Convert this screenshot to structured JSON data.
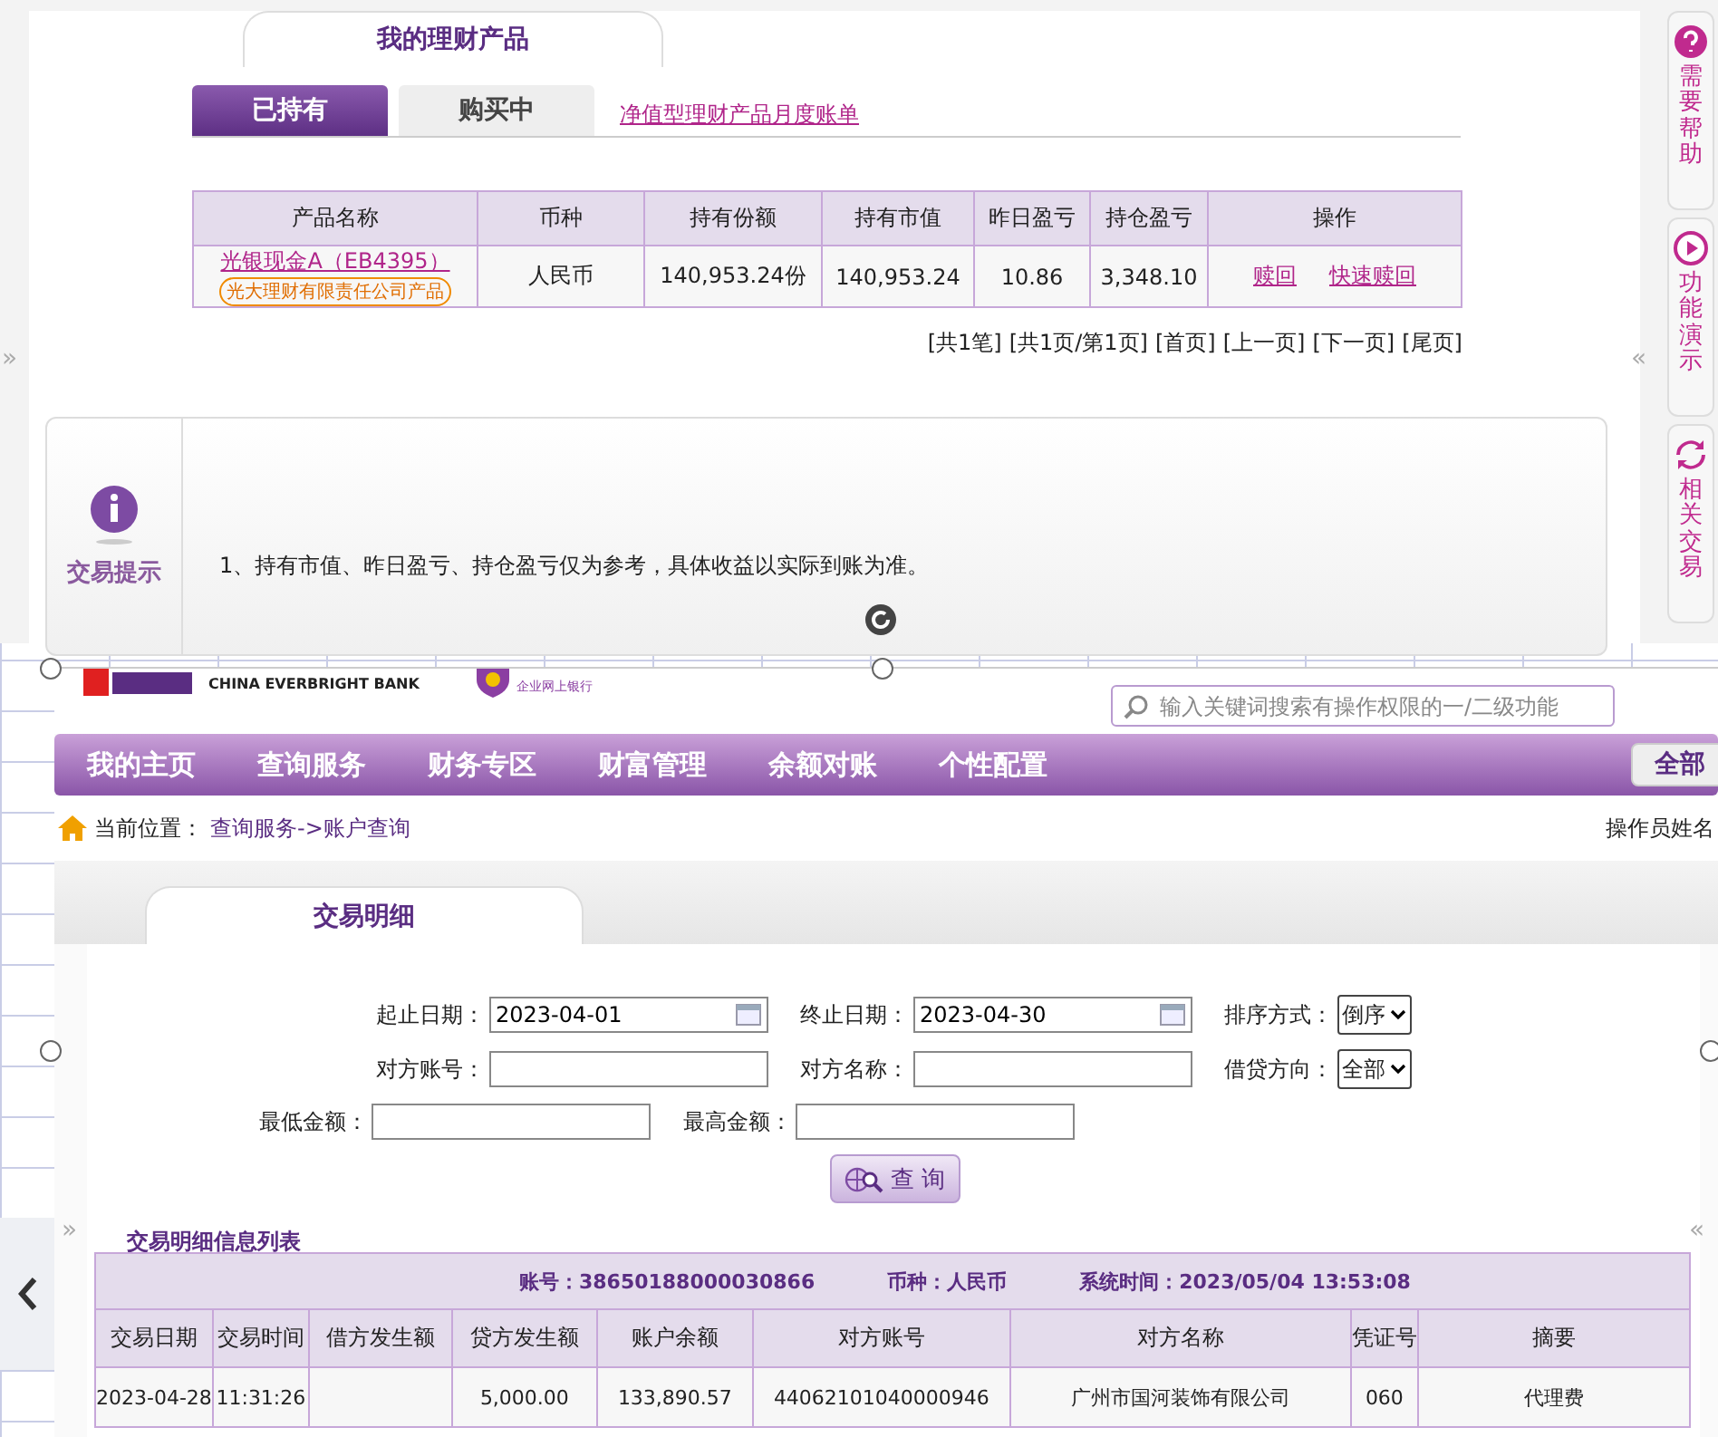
{
  "top_page": {
    "section_title": "我的理财产品",
    "tabs": [
      {
        "label": "已持有",
        "selected": true
      },
      {
        "label": "购买中",
        "selected": false
      }
    ],
    "statement_link": "净值型理财产品月度账单",
    "table": {
      "columns": [
        "产品名称",
        "币种",
        "持有份额",
        "持有市值",
        "昨日盈亏",
        "持仓盈亏",
        "操作"
      ],
      "rows": [
        {
          "product_name": "光银现金A（EB4395）",
          "issuer_badge": "光大理财有限责任公司产品",
          "currency": "人民币",
          "shares": "140,953.24份",
          "market_value": "140,953.24",
          "yesterday_pnl": "10.86",
          "position_pnl": "3,348.10",
          "actions": [
            "赎回",
            "快速赎回"
          ]
        }
      ]
    },
    "pagination": [
      "[共1笔]",
      "[共1页/第1页]",
      "[首页]",
      "[上一页]",
      "[下一页]",
      "[尾页]"
    ],
    "tips": {
      "label": "交易提示",
      "items": [
        "1、持有市值、昨日盈亏、持仓盈亏仅为参考，具体收益以实际到账为准。"
      ]
    },
    "left_toggle": "»",
    "right_toggle": "«",
    "side_buttons": [
      {
        "kind": "help",
        "label": "需要帮助"
      },
      {
        "kind": "demo",
        "label": "功能演示"
      },
      {
        "kind": "related",
        "label": "相关交易"
      }
    ]
  },
  "bottom_page": {
    "bank_name_en": "CHINA EVERBRIGHT BANK",
    "portal_label": "企业网上银行",
    "search": {
      "placeholder": "输入关键词搜索有操作权限的一/二级功能"
    },
    "nav": [
      "我的主页",
      "查询服务",
      "财务专区",
      "财富管理",
      "余额对账",
      "个性配置"
    ],
    "nav_all": "全部",
    "breadcrumb": {
      "label": "当前位置：",
      "path": "查询服务->账户查询"
    },
    "operator": "操作员姓名",
    "section_title": "交易明细",
    "form": [
      [
        {
          "kind": "date",
          "label": "起止日期：",
          "value": "2023-04-01"
        },
        {
          "kind": "date",
          "label": "终止日期：",
          "value": "2023-04-30"
        },
        {
          "kind": "select",
          "label": "排序方式：",
          "value": "倒序"
        }
      ],
      [
        {
          "kind": "text",
          "label": "对方账号："
        },
        {
          "kind": "text",
          "label": "对方名称："
        },
        {
          "kind": "select",
          "label": "借贷方向：",
          "value": "全部"
        }
      ],
      [
        {
          "kind": "text",
          "label": "最低金额："
        },
        {
          "kind": "text",
          "label": "最高金额："
        }
      ]
    ],
    "query_button": "查 询",
    "left_toggle": "»",
    "right_toggle": "«",
    "list_title": "交易明细信息列表",
    "list_info": [
      "账号：38650188000030866",
      "币种：人民币",
      "系统时间：2023/05/04 13:53:08"
    ],
    "table": {
      "columns": [
        "交易日期",
        "交易时间",
        "借方发生额",
        "贷方发生额",
        "账户余额",
        "对方账号",
        "对方名称",
        "凭证号",
        "摘要"
      ],
      "rows": [
        [
          "2023-04-28",
          "11:31:26",
          "",
          "5,000.00",
          "133,890.57",
          "44062101040000946",
          "广州市国河装饰有限公司",
          "060",
          "代理费"
        ]
      ]
    }
  }
}
